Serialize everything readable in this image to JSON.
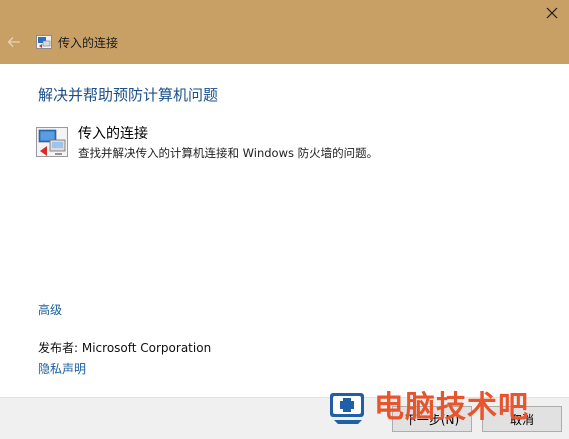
{
  "window": {
    "title": "传入的连接",
    "close_glyph": "✕",
    "back_glyph": "←",
    "accent_color": "#c8a065"
  },
  "main": {
    "heading": "解决并帮助预防计算机问题",
    "item": {
      "title": "传入的连接",
      "description": "查找并解决传入的计算机连接和 Windows 防火墙的问题。",
      "icon": "network-connection-icon"
    },
    "advanced_link": "高级",
    "publisher": "发布者: Microsoft Corporation",
    "privacy_link": "隐私声明"
  },
  "footer": {
    "next_label": "下一步(N)",
    "cancel_label": "取消"
  },
  "watermark": {
    "text": "电脑技术吧"
  }
}
